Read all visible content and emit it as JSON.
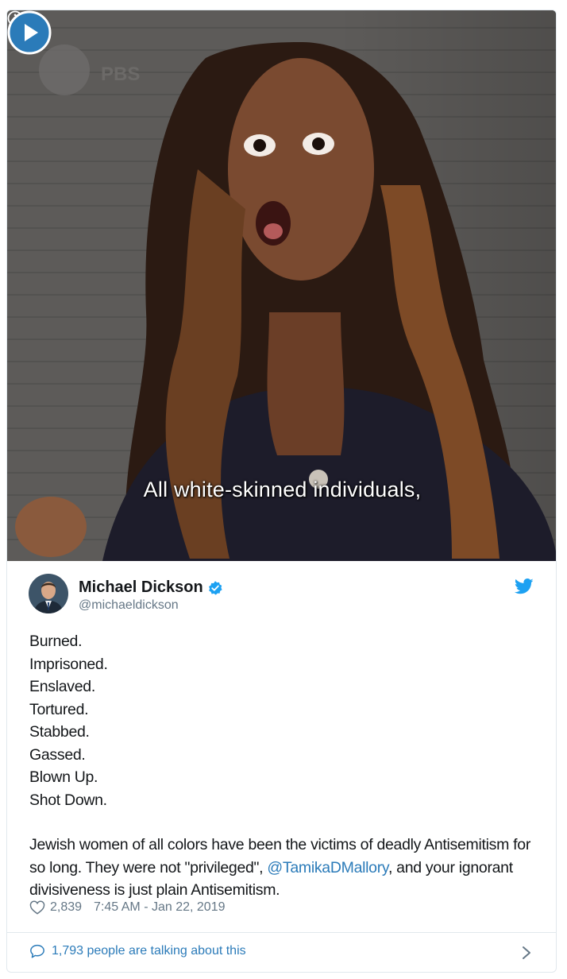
{
  "media": {
    "caption": "All white-skinned individuals,",
    "watermark": "PBS",
    "info_icon": "info-icon",
    "play_icon": "play-icon"
  },
  "author": {
    "display_name": "Michael Dickson",
    "handle": "@michaeldickson",
    "verified": true,
    "avatar_icon": "avatar"
  },
  "tweet": {
    "lines": [
      "Burned.",
      "Imprisoned.",
      "Enslaved.",
      "Tortured.",
      "Stabbed.",
      "Gassed.",
      "Blown Up.",
      "Shot Down."
    ],
    "paragraph_part1": "Jewish women of all colors have been the victims of deadly Antisemitism for so long. They were not \"privileged\", ",
    "mention": "@TamikaDMallory",
    "paragraph_part2": ", and your ignorant divisiveness is just plain Antisemitism."
  },
  "meta": {
    "likes": "2,839",
    "timestamp": "7:45 AM - Jan 22, 2019"
  },
  "footer": {
    "talking": "1,793 people are talking about this"
  },
  "colors": {
    "link": "#2b7bb9",
    "muted": "#657786",
    "twitter_blue": "#1da1f2",
    "border": "#e1e8ed"
  }
}
